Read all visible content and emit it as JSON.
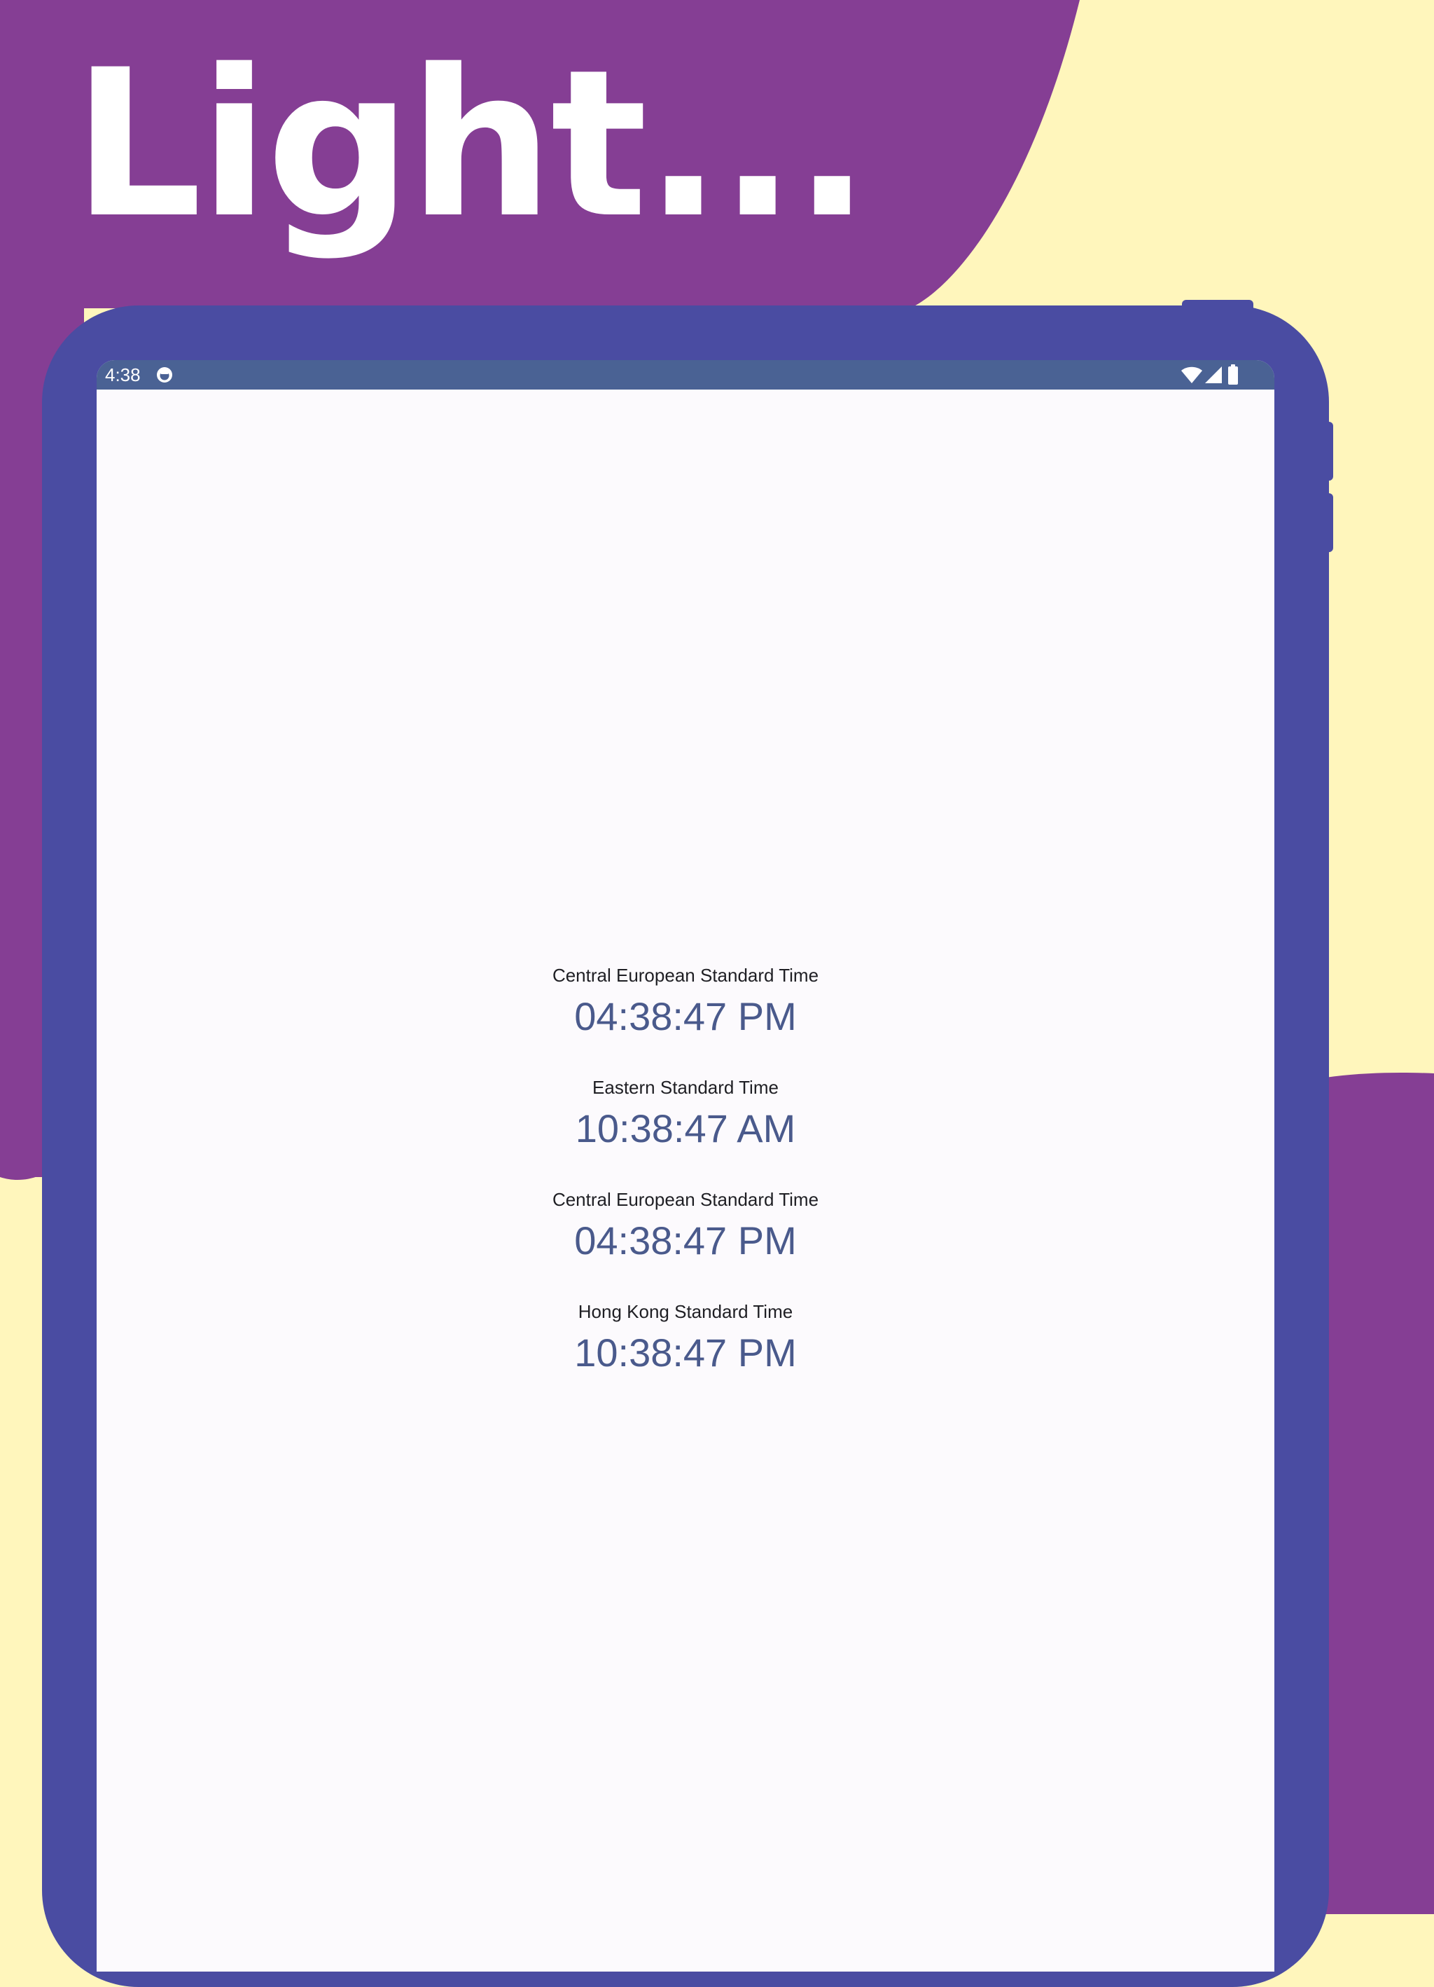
{
  "headline": "Light...",
  "colors": {
    "background_yellow": "#FFF6BC",
    "purple": "#853E94",
    "device_frame": "#4A4CA2",
    "status_bar": "#4A6294",
    "screen": "#FCFAFD",
    "zone_name_text": "#1F1F24",
    "zone_time_text": "#4A5A8C"
  },
  "status_bar": {
    "time": "4:38",
    "icons": [
      "notification-icon",
      "wifi-icon",
      "signal-icon",
      "battery-icon"
    ]
  },
  "clocks": [
    {
      "zone": "Central European Standard Time",
      "time": "04:38:47 PM"
    },
    {
      "zone": "Eastern Standard Time",
      "time": "10:38:47 AM"
    },
    {
      "zone": "Central European Standard Time",
      "time": "04:38:47 PM"
    },
    {
      "zone": "Hong Kong Standard Time",
      "time": "10:38:47 PM"
    }
  ]
}
